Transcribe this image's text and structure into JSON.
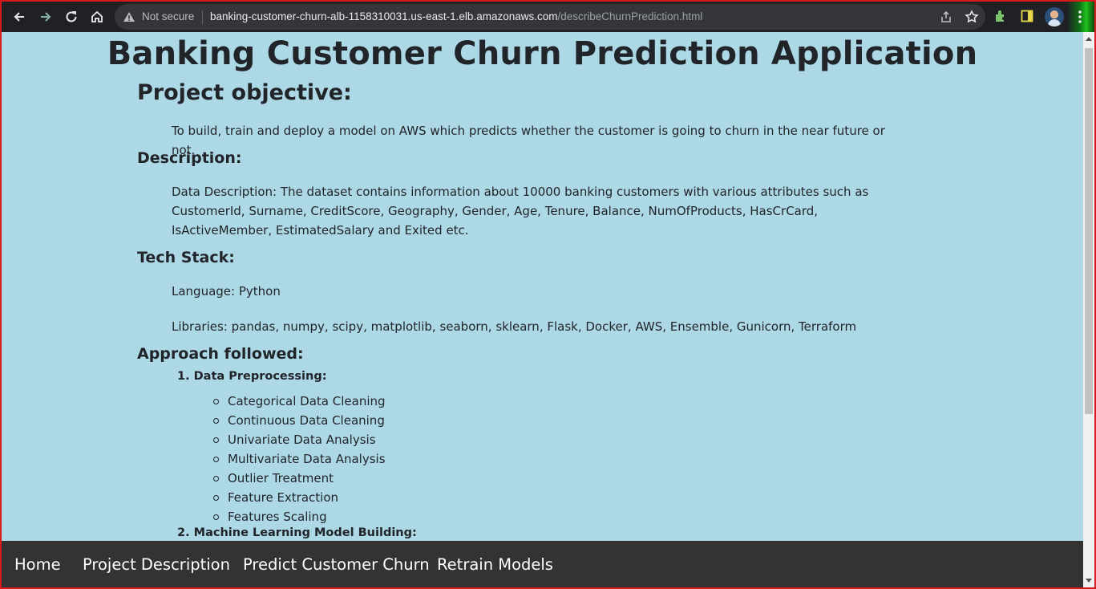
{
  "browser": {
    "security_label": "Not secure",
    "url_host": "banking-customer-churn-alb-1158310031.us-east-1.elb.amazonaws.com",
    "url_path": "/describeChurnPrediction.html",
    "icons": [
      "back-arrow-icon",
      "forward-arrow-icon",
      "reload-icon",
      "home-icon",
      "warning-icon",
      "share-icon",
      "star-icon",
      "extensions-icon",
      "side-panel-icon",
      "avatar",
      "menu-icon"
    ]
  },
  "page": {
    "title": "Banking Customer Churn Prediction Application",
    "objective_heading": "Project objective:",
    "objective_text": "To build, train and deploy a model on AWS which predicts whether the customer is going to churn in the near future or not.",
    "description_heading": "Description:",
    "description_text": "Data Description: The dataset contains information about 10000 banking customers with various attributes such as CustomerId, Surname, CreditScore, Geography, Gender, Age, Tenure, Balance, NumOfProducts, HasCrCard, IsActiveMember, EstimatedSalary and Exited etc.",
    "tech_heading": "Tech Stack:",
    "language_text": "Language: Python",
    "libraries_text": "Libraries: pandas, numpy, scipy, matplotlib, seaborn, sklearn, Flask, Docker, AWS, Ensemble, Gunicorn, Terraform",
    "approach_heading": "Approach followed:",
    "steps": [
      {
        "label": "1. Data Preprocessing:",
        "items": [
          "Categorical Data Cleaning",
          "Continuous Data Cleaning",
          "Univariate Data Analysis",
          "Multivariate Data Analysis",
          "Outlier Treatment",
          "Feature Extraction",
          "Features Scaling"
        ]
      },
      {
        "label": "2. Machine Learning Model Building:"
      }
    ]
  },
  "nav": {
    "items": [
      "Home",
      "Project Description",
      "Predict Customer Churn",
      "Retrain Models"
    ]
  },
  "colors": {
    "page_background": "#add8e6",
    "navbar_background": "#333333",
    "browser_chrome": "#202124"
  }
}
